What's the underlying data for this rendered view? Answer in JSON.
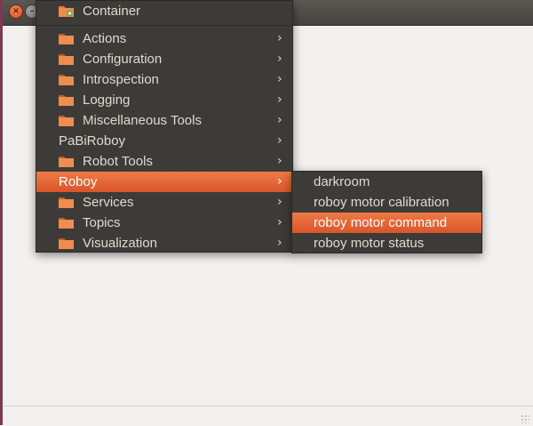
{
  "window": {
    "close_glyph": "×",
    "minimize_glyph": "–"
  },
  "menu": {
    "items": [
      {
        "label": "Container",
        "icon": "folder-add-icon",
        "submenu": false
      },
      {
        "label": "Actions",
        "icon": "folder-icon",
        "submenu": true
      },
      {
        "label": "Configuration",
        "icon": "folder-icon",
        "submenu": true
      },
      {
        "label": "Introspection",
        "icon": "folder-icon",
        "submenu": true
      },
      {
        "label": "Logging",
        "icon": "folder-icon",
        "submenu": true
      },
      {
        "label": "Miscellaneous Tools",
        "icon": "folder-icon",
        "submenu": true
      },
      {
        "label": "PaBiRoboy",
        "icon": null,
        "submenu": true
      },
      {
        "label": "Robot Tools",
        "icon": "folder-icon",
        "submenu": true
      },
      {
        "label": "Roboy",
        "icon": null,
        "submenu": true,
        "active": true
      },
      {
        "label": "Services",
        "icon": "folder-icon",
        "submenu": true
      },
      {
        "label": "Topics",
        "icon": "folder-icon",
        "submenu": true
      },
      {
        "label": "Visualization",
        "icon": "folder-icon",
        "submenu": true
      }
    ],
    "chevron": "›"
  },
  "submenu": {
    "items": [
      {
        "label": "darkroom"
      },
      {
        "label": "roboy motor calibration"
      },
      {
        "label": "roboy motor command",
        "active": true
      },
      {
        "label": "roboy motor status"
      }
    ]
  },
  "colors": {
    "menu_bg": "#3c3b37",
    "menu_text": "#dfdbd2",
    "highlight": "#e0622f",
    "folder": "#e8773a"
  }
}
